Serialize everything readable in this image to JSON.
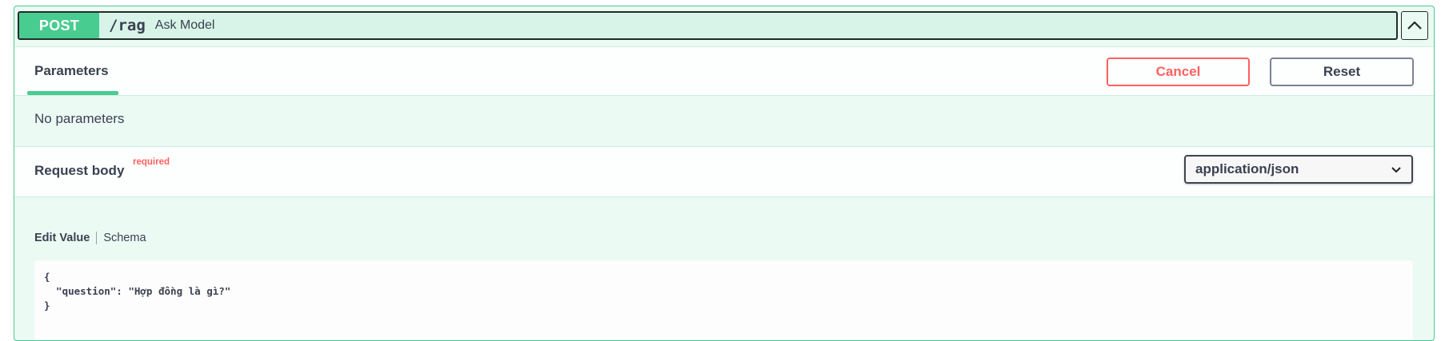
{
  "operation": {
    "method": "POST",
    "path": "/rag",
    "summary": "Ask Model"
  },
  "tabs": {
    "parameters": "Parameters"
  },
  "buttons": {
    "cancel": "Cancel",
    "reset": "Reset"
  },
  "parameters": {
    "empty_text": "No parameters"
  },
  "request_body": {
    "title": "Request body",
    "required_label": "required",
    "content_type": "application/json",
    "edit_tabs": {
      "edit_value": "Edit Value",
      "schema": "Schema"
    },
    "editor_lines": {
      "l1": "{",
      "l2": "  \"question\": \"Hợp đồng là gì?\"",
      "l3": "}"
    }
  },
  "colors": {
    "post_green": "#49cc90",
    "cancel_red": "#ff6060",
    "text": "#3b4151"
  },
  "icons": {
    "collapse": "chevron-up-icon",
    "select": "chevron-down-icon"
  }
}
